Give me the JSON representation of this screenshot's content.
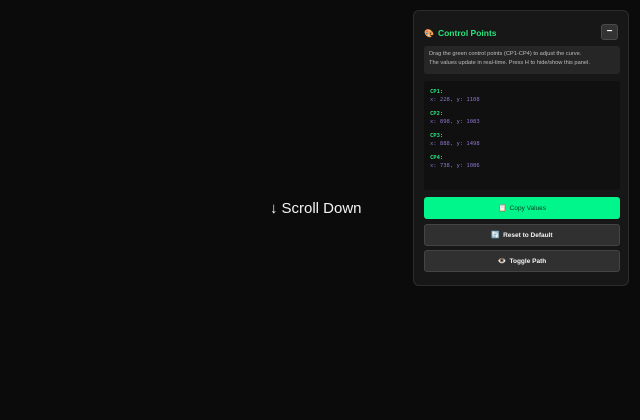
{
  "scroll_hint": {
    "arrow": "↓",
    "label": "Scroll Down"
  },
  "panel": {
    "title_icon": "🎨",
    "title": "Control Points",
    "collapse_label": "−",
    "info_line1": "Drag the green control points (CP1-CP4) to adjust the curve.",
    "info_line2": "The values update in real-time. Press H to hide/show this panel.",
    "control_points": [
      {
        "label": "CP1:",
        "value": "x: 228, y: 1108"
      },
      {
        "label": "CP2:",
        "value": "x: 898, y: 1083"
      },
      {
        "label": "CP3:",
        "value": "x: 888, y: 1498"
      },
      {
        "label": "CP4:",
        "value": "x: 738, y: 1086"
      }
    ],
    "buttons": {
      "copy": {
        "icon": "📋",
        "label": "Copy Values"
      },
      "reset": {
        "icon": "🔄",
        "label": "Reset to Default"
      },
      "toggle": {
        "icon": "👁️",
        "label": "Toggle Path"
      }
    }
  },
  "colors": {
    "accent_green": "#27e37d",
    "copy_button_bg": "#00f58a",
    "value_purple": "#8a74c8",
    "background": "#0b0b0b"
  }
}
